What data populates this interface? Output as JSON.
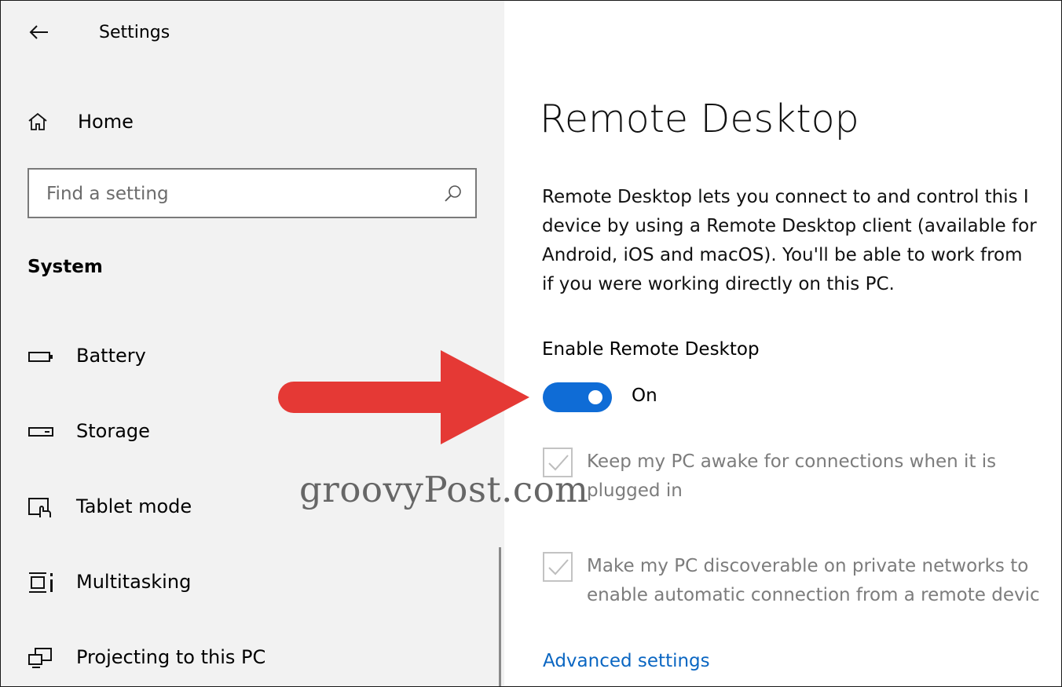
{
  "window": {
    "title": "Settings",
    "back_icon": "back-arrow-icon"
  },
  "sidebar": {
    "home": {
      "label": "Home",
      "icon": "home-icon"
    },
    "search": {
      "placeholder": "Find a setting",
      "icon": "search-icon"
    },
    "section_title": "System",
    "items": [
      {
        "label": "Battery",
        "icon": "battery-icon"
      },
      {
        "label": "Storage",
        "icon": "storage-icon"
      },
      {
        "label": "Tablet mode",
        "icon": "tablet-mode-icon"
      },
      {
        "label": "Multitasking",
        "icon": "multitasking-icon"
      },
      {
        "label": "Projecting to this PC",
        "icon": "projecting-icon"
      }
    ]
  },
  "main": {
    "title": "Remote Desktop",
    "description_lines": [
      "Remote Desktop lets you connect to and control this I",
      "device by using a Remote Desktop client (available for",
      "Android, iOS and macOS). You'll be able to work from",
      "if you were working directly on this PC."
    ],
    "enable_label": "Enable Remote Desktop",
    "toggle": {
      "state_label": "On",
      "is_on": true
    },
    "checkboxes": [
      {
        "lines": [
          "Keep my PC awake for connections when it is",
          "plugged in"
        ],
        "checked": true,
        "disabled": true
      },
      {
        "lines": [
          "Make my PC discoverable on private networks to",
          "enable automatic connection from a remote devic"
        ],
        "checked": true,
        "disabled": true
      }
    ],
    "advanced_link": "Advanced settings"
  },
  "overlay": {
    "watermark": "groovyPost.com",
    "arrow_color": "#e53935"
  },
  "colors": {
    "accent": "#0f6cd6",
    "link": "#0a66c2",
    "sidebar_bg": "#f2f2f2",
    "disabled_text": "#7c7c7c"
  }
}
